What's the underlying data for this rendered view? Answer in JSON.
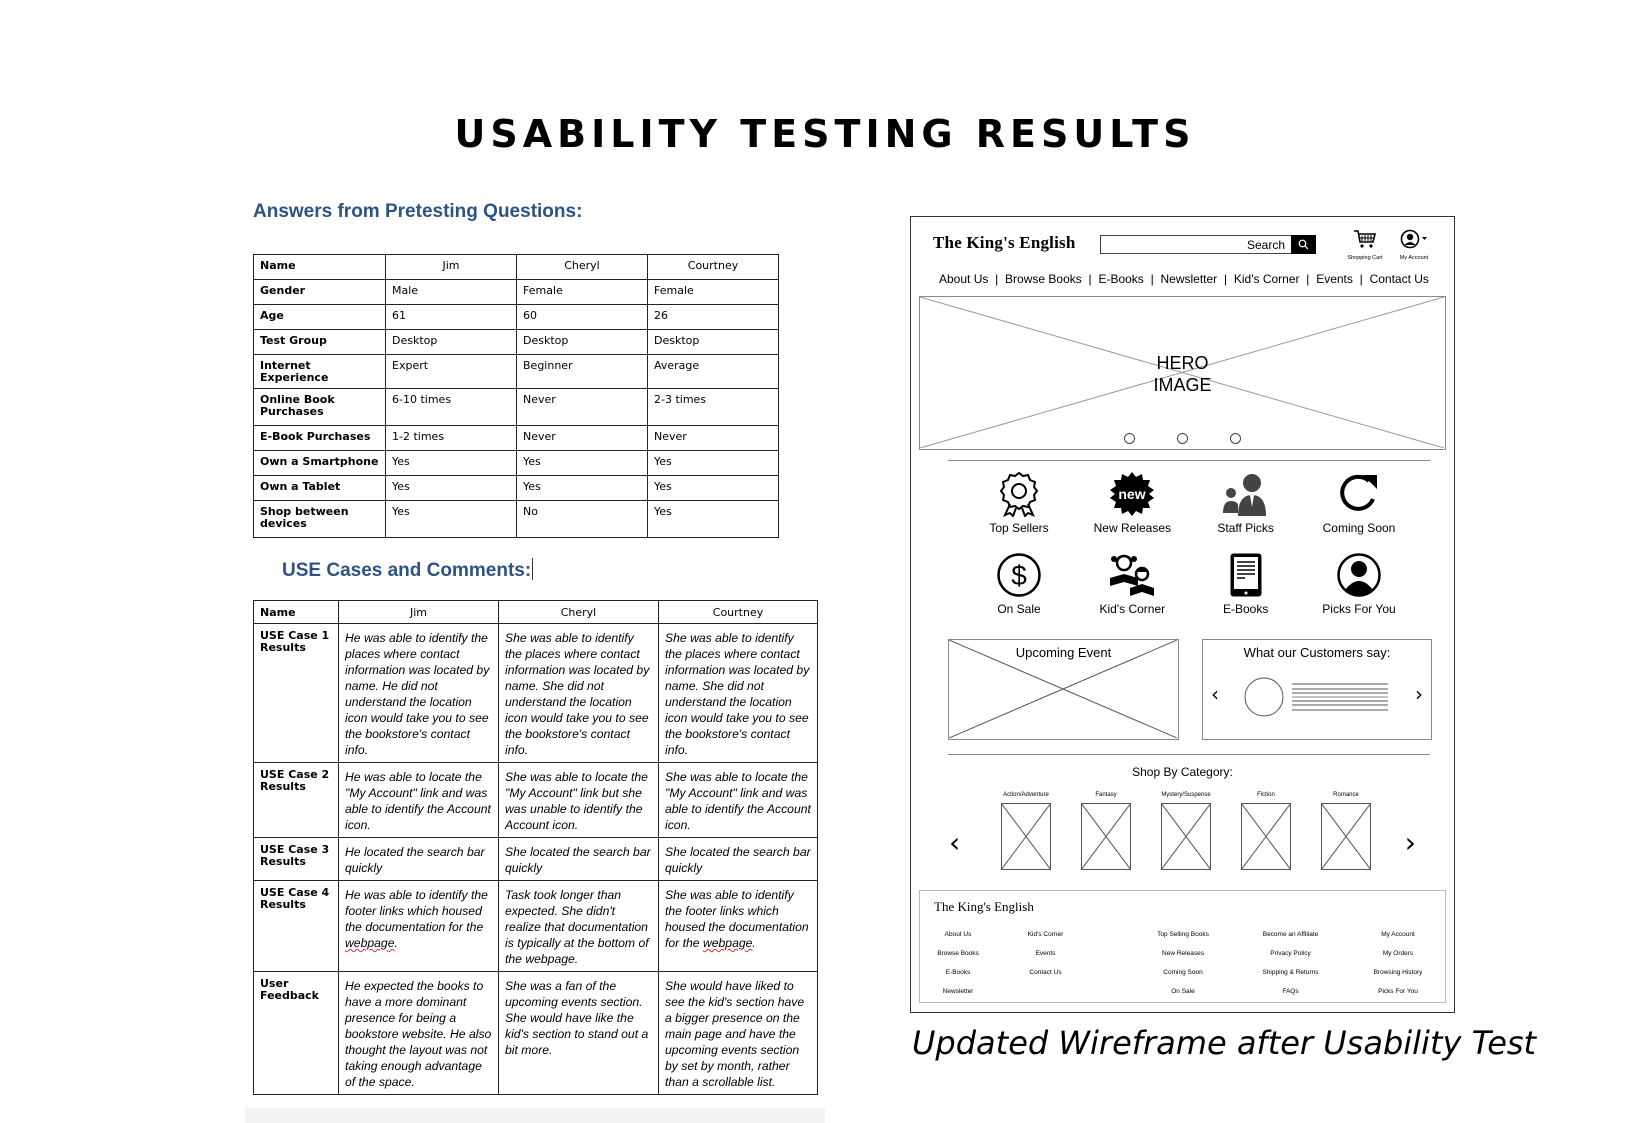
{
  "page": {
    "title": "USABILITY TESTING RESULTS"
  },
  "pretest": {
    "heading": "Answers from Pretesting Questions:",
    "header": [
      "Name",
      "Jim",
      "Cheryl",
      "Courtney"
    ],
    "rows": [
      [
        "Gender",
        "Male",
        "Female",
        "Female"
      ],
      [
        "Age",
        "61",
        "60",
        "26"
      ],
      [
        "Test Group",
        "Desktop",
        "Desktop",
        "Desktop"
      ],
      [
        "Internet Experience",
        "Expert",
        "Beginner",
        "Average"
      ],
      [
        "Online Book Purchases",
        "6-10 times",
        "Never",
        "2-3 times"
      ],
      [
        "E-Book Purchases",
        "1-2 times",
        "Never",
        "Never"
      ],
      [
        "Own a Smartphone",
        "Yes",
        "Yes",
        "Yes"
      ],
      [
        "Own a Tablet",
        "Yes",
        "Yes",
        "Yes"
      ],
      [
        "Shop between devices",
        "Yes",
        "No",
        "Yes"
      ]
    ]
  },
  "usecases": {
    "heading": "USE Cases and Comments:",
    "header": [
      "Name",
      "Jim",
      "Cheryl",
      "Courtney"
    ],
    "rows": [
      [
        "USE Case 1 Results",
        "He was able to identify the places where contact information was located by name. He did not understand the location icon would take you to see the bookstore's contact info.",
        "She was able to identify the places where contact information was located by name. She did not understand the location icon would take you to see the bookstore's contact info.",
        "She was able to identify the places where contact information was located by name. She did not understand the location icon would take you to see the bookstore's contact info."
      ],
      [
        "USE Case 2 Results",
        "He was able to locate the \"My Account\" link and was able to identify the Account icon.",
        "She was able to locate the \"My Account\" link but she was unable to identify the Account icon.",
        "She was able to locate the \"My Account\" link and was able to identify the Account icon."
      ],
      [
        "USE Case 3 Results",
        "He located the search bar quickly",
        "She located the search bar quickly",
        "She located the search bar quickly"
      ],
      [
        "USE Case 4 Results",
        "He was able to identify the footer links which housed the documentation for the ",
        "Task took longer than expected. She didn't realize that documentation is typically at the bottom of the webpage.",
        "She was able to identify the footer links which housed the documentation for the "
      ],
      [
        "User Feedback",
        "He expected the books to have a more dominant presence for being a bookstore website. He also thought the layout was not taking enough advantage of the space.",
        "She was a fan of the upcoming events section. She would have like the kid's section to stand out a bit more.",
        "She would have liked to see the kid's section have a bigger presence on the main page and have the upcoming events section by set by month, rather than a scrollable list."
      ]
    ],
    "misspelled_word": "webpage",
    "misspelled_suffix": "."
  },
  "wireframe": {
    "logo": "The King's English",
    "search_label": "Search",
    "cart_label": "Shopping Cart",
    "account_label": "My Account",
    "nav": [
      "About Us",
      "Browse Books",
      "E-Books",
      "Newsletter",
      "Kid's Corner",
      "Events",
      "Contact Us"
    ],
    "hero_line1": "HERO",
    "hero_line2": "IMAGE",
    "icons_row1": [
      {
        "label": "Top Sellers",
        "icon": "award-ribbon-icon"
      },
      {
        "label": "New Releases",
        "icon": "new-badge-icon"
      },
      {
        "label": "Staff Picks",
        "icon": "staff-people-icon"
      },
      {
        "label": "Coming Soon",
        "icon": "refresh-arrow-icon"
      }
    ],
    "icons_row2": [
      {
        "label": "On Sale",
        "icon": "dollar-circle-icon"
      },
      {
        "label": "Kid's Corner",
        "icon": "kids-reading-icon"
      },
      {
        "label": "E-Books",
        "icon": "tablet-ebook-icon"
      },
      {
        "label": "Picks For You",
        "icon": "user-circle-icon"
      }
    ],
    "new_badge_text": "new",
    "upcoming_event": "Upcoming Event",
    "customers_say": "What our Customers say:",
    "shop_by_category": "Shop By Category:",
    "categories": [
      "Action/Adventure",
      "Fantasy",
      "Mystery/Suspense",
      "Fiction",
      "Romance"
    ],
    "footer_logo": "The King's English",
    "footer_cols": [
      [
        "About Us",
        "Browse Books",
        "E-Books",
        "Newsletter"
      ],
      [
        "Kid's Corner",
        "Events",
        "Contact Us"
      ],
      [
        "Top Selling Books",
        "New Releases",
        "Coming Soon",
        "On Sale"
      ],
      [
        "Become an Affiliate",
        "Privacy Policy",
        "Shipping & Returns",
        "FAQs"
      ],
      [
        "My Account",
        "My Orders",
        "Browsing History",
        "Picks For You"
      ]
    ]
  },
  "caption": "Updated Wireframe after Usability Test"
}
